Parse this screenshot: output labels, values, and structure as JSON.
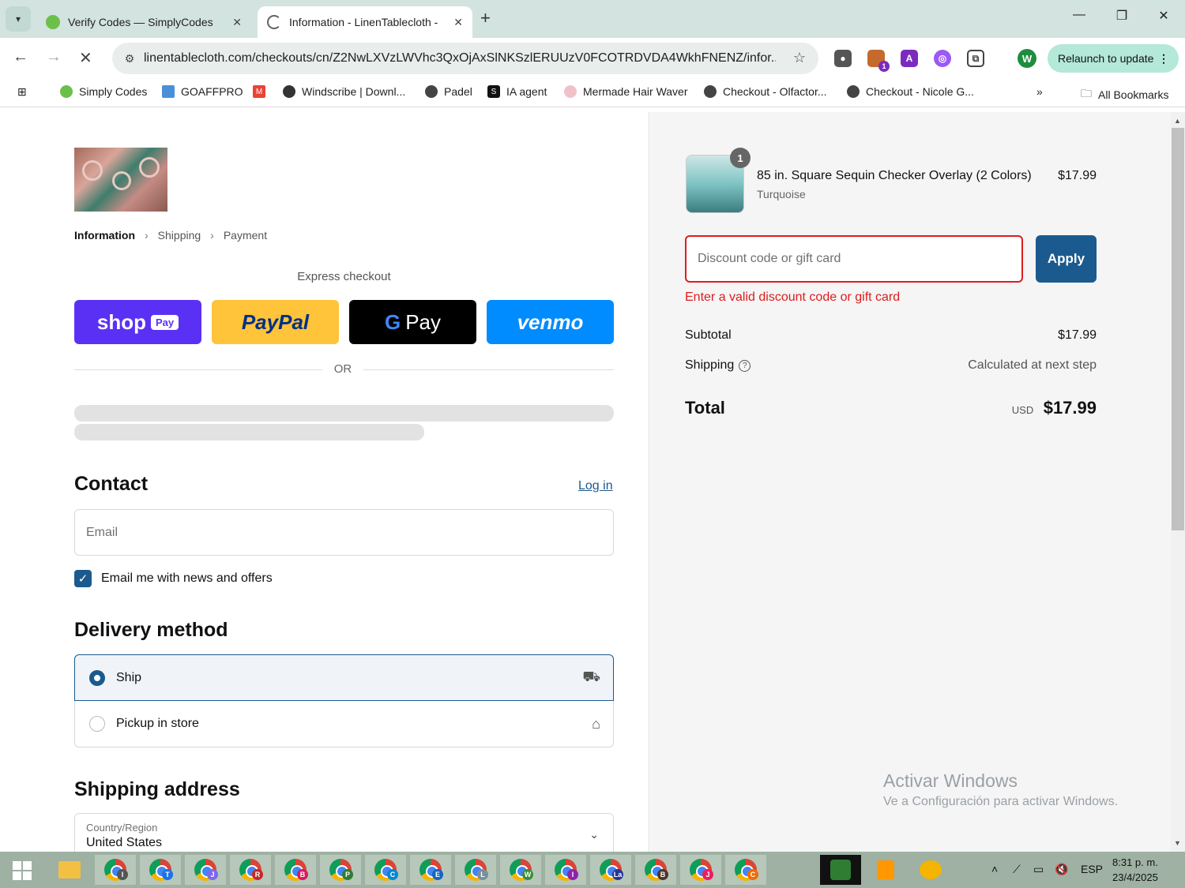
{
  "browser": {
    "tabs": [
      {
        "title": "Verify Codes — SimplyCodes",
        "active": false
      },
      {
        "title": "Information - LinenTablecloth -",
        "active": true
      }
    ],
    "url": "linentablecloth.com/checkouts/cn/Z2NwLXVzLWVhc3QxOjAxSlNKSzlERUUzV0FCOTRDVDA4WkhFNENZ/infor...",
    "avatar_letter": "W",
    "relaunch_label": "Relaunch to update",
    "extension_badge": "1",
    "bookmarks": [
      "Simply Codes",
      "GOAFFPRO",
      "Windscribe | Downl...",
      "Padel",
      "IA agent",
      "Mermade Hair Waver",
      "Checkout - Olfactor...",
      "Checkout - Nicole G..."
    ],
    "all_bookmarks_label": "All Bookmarks"
  },
  "checkout": {
    "breadcrumb": {
      "current": "Information",
      "step2": "Shipping",
      "step3": "Payment"
    },
    "express_label": "Express checkout",
    "pay_buttons": {
      "shop": "shop",
      "shop_badge": "Pay",
      "paypal": "PayPal",
      "gpay": "Pay",
      "venmo": "venmo"
    },
    "or_label": "OR",
    "contact_title": "Contact",
    "login_label": "Log in",
    "email_placeholder": "Email",
    "news_checkbox_label": "Email me with news and offers",
    "delivery_title": "Delivery method",
    "delivery_options": {
      "ship": "Ship",
      "pickup": "Pickup in store"
    },
    "shipping_title": "Shipping address",
    "country_label": "Country/Region",
    "country_value": "United States"
  },
  "summary": {
    "qty": "1",
    "product_name": "85 in. Square Sequin Checker Overlay (2 Colors)",
    "product_variant": "Turquoise",
    "product_price": "$17.99",
    "discount_placeholder": "Discount code or gift card",
    "apply_label": "Apply",
    "discount_error": "Enter a valid discount code or gift card",
    "subtotal_label": "Subtotal",
    "subtotal_value": "$17.99",
    "shipping_label": "Shipping",
    "shipping_value": "Calculated at next step",
    "total_label": "Total",
    "total_currency": "USD",
    "total_value": "$17.99"
  },
  "watermark": {
    "line1": "Activar Windows",
    "line2": "Ve a Configuración para activar Windows."
  },
  "taskbar": {
    "badges": [
      "I",
      "T",
      "J",
      "R",
      "B",
      "P",
      "C",
      "E",
      "L",
      "W",
      "I",
      "La",
      "B",
      "J",
      "C"
    ],
    "lang": "ESP",
    "time": "8:31 p. m.",
    "date": "23/4/2025"
  },
  "colors": {
    "accent": "#1b5a8e",
    "error": "#dd1d1d",
    "shop_pay": "#5a31f4",
    "paypal": "#ffc439",
    "venmo": "#008cff"
  }
}
